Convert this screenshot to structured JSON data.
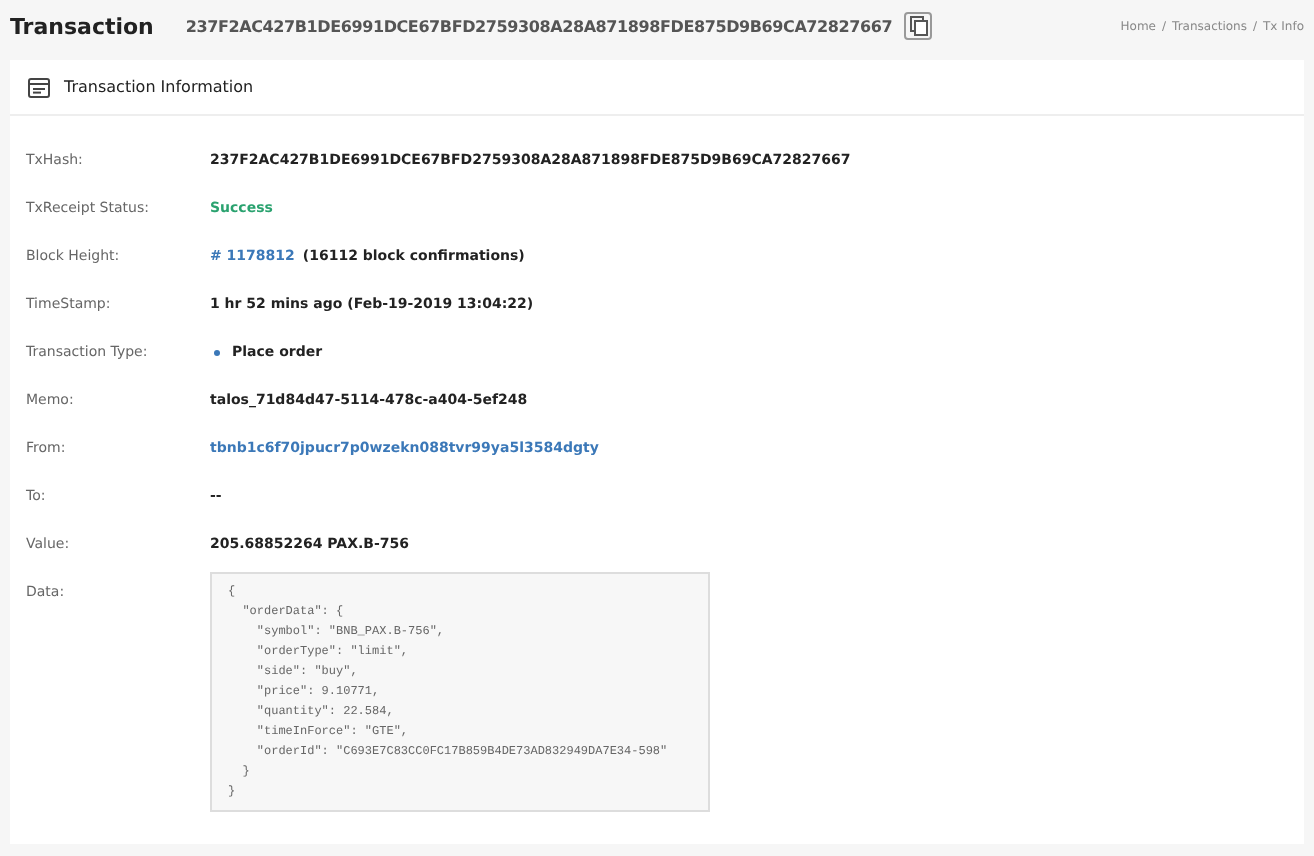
{
  "header": {
    "title": "Transaction",
    "hash": "237F2AC427B1DE6991DCE67BFD2759308A28A871898FDE875D9B69CA72827667",
    "breadcrumb": [
      "Home",
      "Transactions",
      "Tx Info"
    ],
    "breadcrumb_separator": "/"
  },
  "card": {
    "title": "Transaction Information",
    "rows": [
      {
        "label": "TxHash:",
        "kind": "text",
        "value": "237F2AC427B1DE6991DCE67BFD2759308A28A871898FDE875D9B69CA72827667"
      },
      {
        "label": "TxReceipt Status:",
        "kind": "status",
        "value": "Success"
      },
      {
        "label": "Block Height:",
        "kind": "block",
        "link": "# 1178812",
        "value": "(16112 block confirmations)"
      },
      {
        "label": "TimeStamp:",
        "kind": "text",
        "value": "1 hr 52 mins ago (Feb-19-2019 13:04:22)"
      },
      {
        "label": "Transaction Type:",
        "kind": "type",
        "value": "Place order"
      },
      {
        "label": "Memo:",
        "kind": "text",
        "value": "talos_71d84d47-5114-478c-a404-5ef248"
      },
      {
        "label": "From:",
        "kind": "link",
        "value": "tbnb1c6f70jpucr7p0wzekn088tvr99ya5l3584dgty"
      },
      {
        "label": "To:",
        "kind": "text",
        "value": "--"
      },
      {
        "label": "Value:",
        "kind": "text",
        "value": "205.68852264 PAX.B-756"
      },
      {
        "label": "Data:",
        "kind": "code",
        "value": "{\n  \"orderData\": {\n    \"symbol\": \"BNB_PAX.B-756\",\n    \"orderType\": \"limit\",\n    \"side\": \"buy\",\n    \"price\": 9.10771,\n    \"quantity\": 22.584,\n    \"timeInForce\": \"GTE\",\n    \"orderId\": \"C693E7C83CC0FC17B859B4DE73AD832949DA7E34-598\"\n  }\n}"
      }
    ]
  }
}
